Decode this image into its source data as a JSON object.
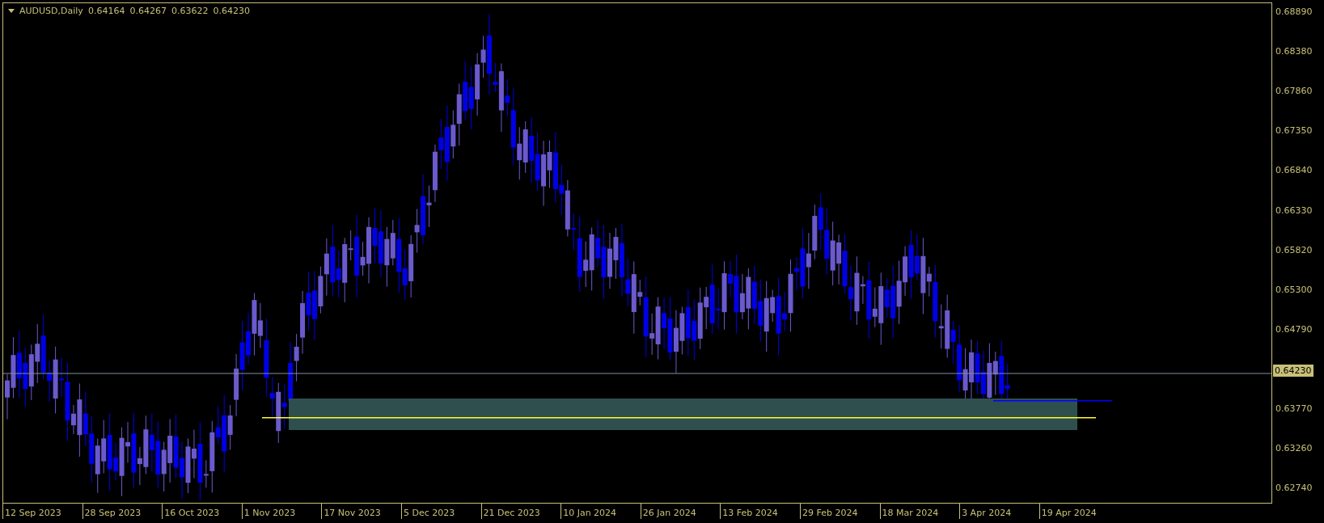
{
  "chart_header": {
    "symbol": "AUDUSD,Daily",
    "ohlc": [
      "0.64164",
      "0.64267",
      "0.63622",
      "0.64230"
    ]
  },
  "price_axis": [
    "0.68890",
    "0.68380",
    "0.67860",
    "0.67350",
    "0.66840",
    "0.66330",
    "0.65820",
    "0.65300",
    "0.64790",
    "0.63770",
    "0.63260",
    "0.62740"
  ],
  "current_price": "0.64230",
  "date_axis": [
    "12 Sep 2023",
    "28 Sep 2023",
    "16 Oct 2023",
    "1 Nov 2023",
    "17 Nov 2023",
    "5 Dec 2023",
    "21 Dec 2023",
    "10 Jan 2024",
    "26 Jan 2024",
    "13 Feb 2024",
    "29 Feb 2024",
    "18 Mar 2024",
    "3 Apr 2024",
    "19 Apr 2024"
  ]
}
